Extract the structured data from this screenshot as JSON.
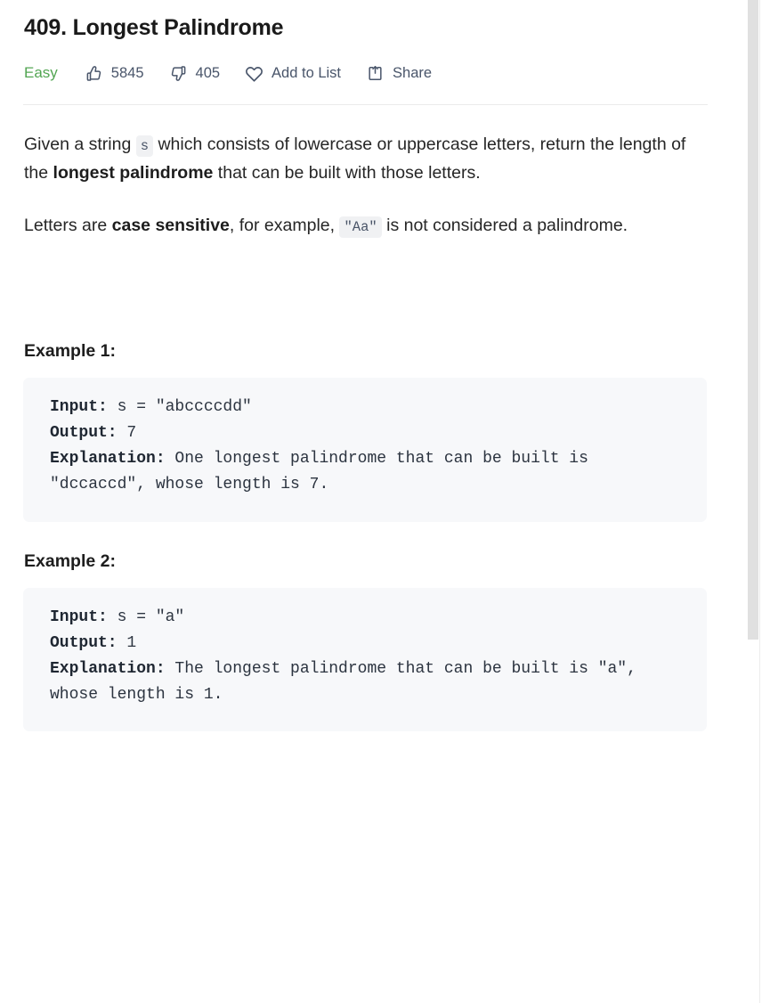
{
  "problem": {
    "title": "409. Longest Palindrome",
    "difficulty": "Easy",
    "difficulty_color": "#53a653"
  },
  "actions": [
    {
      "icon": "thumbs-up-icon",
      "name": "likes",
      "label": "5845"
    },
    {
      "icon": "thumbs-down-icon",
      "name": "dislikes",
      "label": "405"
    },
    {
      "icon": "heart-icon",
      "name": "add-to-list",
      "label": "Add to List"
    },
    {
      "icon": "share-icon",
      "name": "share",
      "label": "Share"
    }
  ],
  "description": {
    "p1_a": "Given a string ",
    "p1_code": "s",
    "p1_b": " which consists of lowercase or uppercase letters, return the length of the ",
    "p1_bold": "longest palindrome",
    "p1_c": " that can be built with those letters.",
    "p2_a": "Letters are ",
    "p2_bold": "case sensitive",
    "p2_b": ", for example, ",
    "p2_code": "\"Aa\"",
    "p2_c": " is not considered a palindrome."
  },
  "examples": [
    {
      "heading": "Example 1:",
      "input_label": "Input:",
      "input_value": " s = \"abccccdd\"",
      "output_label": "Output:",
      "output_value": " 7",
      "explanation_label": "Explanation:",
      "explanation_value": " One longest palindrome that can be built is \"dccaccd\", whose length is 7."
    },
    {
      "heading": "Example 2:",
      "input_label": "Input:",
      "input_value": " s = \"a\"",
      "output_label": "Output:",
      "output_value": " 1",
      "explanation_label": "Explanation:",
      "explanation_value": " The longest palindrome that can be built is \"a\", whose length is 1."
    }
  ],
  "scrollbar": {
    "thumb_color": "#e0e0e0",
    "position": "top"
  }
}
